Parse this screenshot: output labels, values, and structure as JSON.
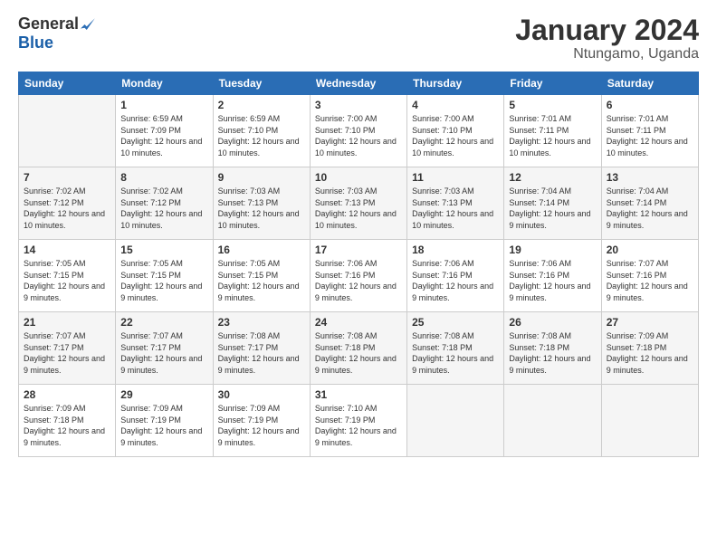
{
  "header": {
    "logo_general": "General",
    "logo_blue": "Blue",
    "month_title": "January 2024",
    "location": "Ntungamo, Uganda"
  },
  "days_of_week": [
    "Sunday",
    "Monday",
    "Tuesday",
    "Wednesday",
    "Thursday",
    "Friday",
    "Saturday"
  ],
  "weeks": [
    [
      {
        "day": "",
        "empty": true
      },
      {
        "day": "1",
        "sunrise": "6:59 AM",
        "sunset": "7:09 PM",
        "daylight": "12 hours and 10 minutes."
      },
      {
        "day": "2",
        "sunrise": "6:59 AM",
        "sunset": "7:10 PM",
        "daylight": "12 hours and 10 minutes."
      },
      {
        "day": "3",
        "sunrise": "7:00 AM",
        "sunset": "7:10 PM",
        "daylight": "12 hours and 10 minutes."
      },
      {
        "day": "4",
        "sunrise": "7:00 AM",
        "sunset": "7:10 PM",
        "daylight": "12 hours and 10 minutes."
      },
      {
        "day": "5",
        "sunrise": "7:01 AM",
        "sunset": "7:11 PM",
        "daylight": "12 hours and 10 minutes."
      },
      {
        "day": "6",
        "sunrise": "7:01 AM",
        "sunset": "7:11 PM",
        "daylight": "12 hours and 10 minutes."
      }
    ],
    [
      {
        "day": "7",
        "sunrise": "7:02 AM",
        "sunset": "7:12 PM",
        "daylight": "12 hours and 10 minutes."
      },
      {
        "day": "8",
        "sunrise": "7:02 AM",
        "sunset": "7:12 PM",
        "daylight": "12 hours and 10 minutes."
      },
      {
        "day": "9",
        "sunrise": "7:03 AM",
        "sunset": "7:13 PM",
        "daylight": "12 hours and 10 minutes."
      },
      {
        "day": "10",
        "sunrise": "7:03 AM",
        "sunset": "7:13 PM",
        "daylight": "12 hours and 10 minutes."
      },
      {
        "day": "11",
        "sunrise": "7:03 AM",
        "sunset": "7:13 PM",
        "daylight": "12 hours and 10 minutes."
      },
      {
        "day": "12",
        "sunrise": "7:04 AM",
        "sunset": "7:14 PM",
        "daylight": "12 hours and 9 minutes."
      },
      {
        "day": "13",
        "sunrise": "7:04 AM",
        "sunset": "7:14 PM",
        "daylight": "12 hours and 9 minutes."
      }
    ],
    [
      {
        "day": "14",
        "sunrise": "7:05 AM",
        "sunset": "7:15 PM",
        "daylight": "12 hours and 9 minutes."
      },
      {
        "day": "15",
        "sunrise": "7:05 AM",
        "sunset": "7:15 PM",
        "daylight": "12 hours and 9 minutes."
      },
      {
        "day": "16",
        "sunrise": "7:05 AM",
        "sunset": "7:15 PM",
        "daylight": "12 hours and 9 minutes."
      },
      {
        "day": "17",
        "sunrise": "7:06 AM",
        "sunset": "7:16 PM",
        "daylight": "12 hours and 9 minutes."
      },
      {
        "day": "18",
        "sunrise": "7:06 AM",
        "sunset": "7:16 PM",
        "daylight": "12 hours and 9 minutes."
      },
      {
        "day": "19",
        "sunrise": "7:06 AM",
        "sunset": "7:16 PM",
        "daylight": "12 hours and 9 minutes."
      },
      {
        "day": "20",
        "sunrise": "7:07 AM",
        "sunset": "7:16 PM",
        "daylight": "12 hours and 9 minutes."
      }
    ],
    [
      {
        "day": "21",
        "sunrise": "7:07 AM",
        "sunset": "7:17 PM",
        "daylight": "12 hours and 9 minutes."
      },
      {
        "day": "22",
        "sunrise": "7:07 AM",
        "sunset": "7:17 PM",
        "daylight": "12 hours and 9 minutes."
      },
      {
        "day": "23",
        "sunrise": "7:08 AM",
        "sunset": "7:17 PM",
        "daylight": "12 hours and 9 minutes."
      },
      {
        "day": "24",
        "sunrise": "7:08 AM",
        "sunset": "7:18 PM",
        "daylight": "12 hours and 9 minutes."
      },
      {
        "day": "25",
        "sunrise": "7:08 AM",
        "sunset": "7:18 PM",
        "daylight": "12 hours and 9 minutes."
      },
      {
        "day": "26",
        "sunrise": "7:08 AM",
        "sunset": "7:18 PM",
        "daylight": "12 hours and 9 minutes."
      },
      {
        "day": "27",
        "sunrise": "7:09 AM",
        "sunset": "7:18 PM",
        "daylight": "12 hours and 9 minutes."
      }
    ],
    [
      {
        "day": "28",
        "sunrise": "7:09 AM",
        "sunset": "7:18 PM",
        "daylight": "12 hours and 9 minutes."
      },
      {
        "day": "29",
        "sunrise": "7:09 AM",
        "sunset": "7:19 PM",
        "daylight": "12 hours and 9 minutes."
      },
      {
        "day": "30",
        "sunrise": "7:09 AM",
        "sunset": "7:19 PM",
        "daylight": "12 hours and 9 minutes."
      },
      {
        "day": "31",
        "sunrise": "7:10 AM",
        "sunset": "7:19 PM",
        "daylight": "12 hours and 9 minutes."
      },
      {
        "day": "",
        "empty": true
      },
      {
        "day": "",
        "empty": true
      },
      {
        "day": "",
        "empty": true
      }
    ]
  ]
}
